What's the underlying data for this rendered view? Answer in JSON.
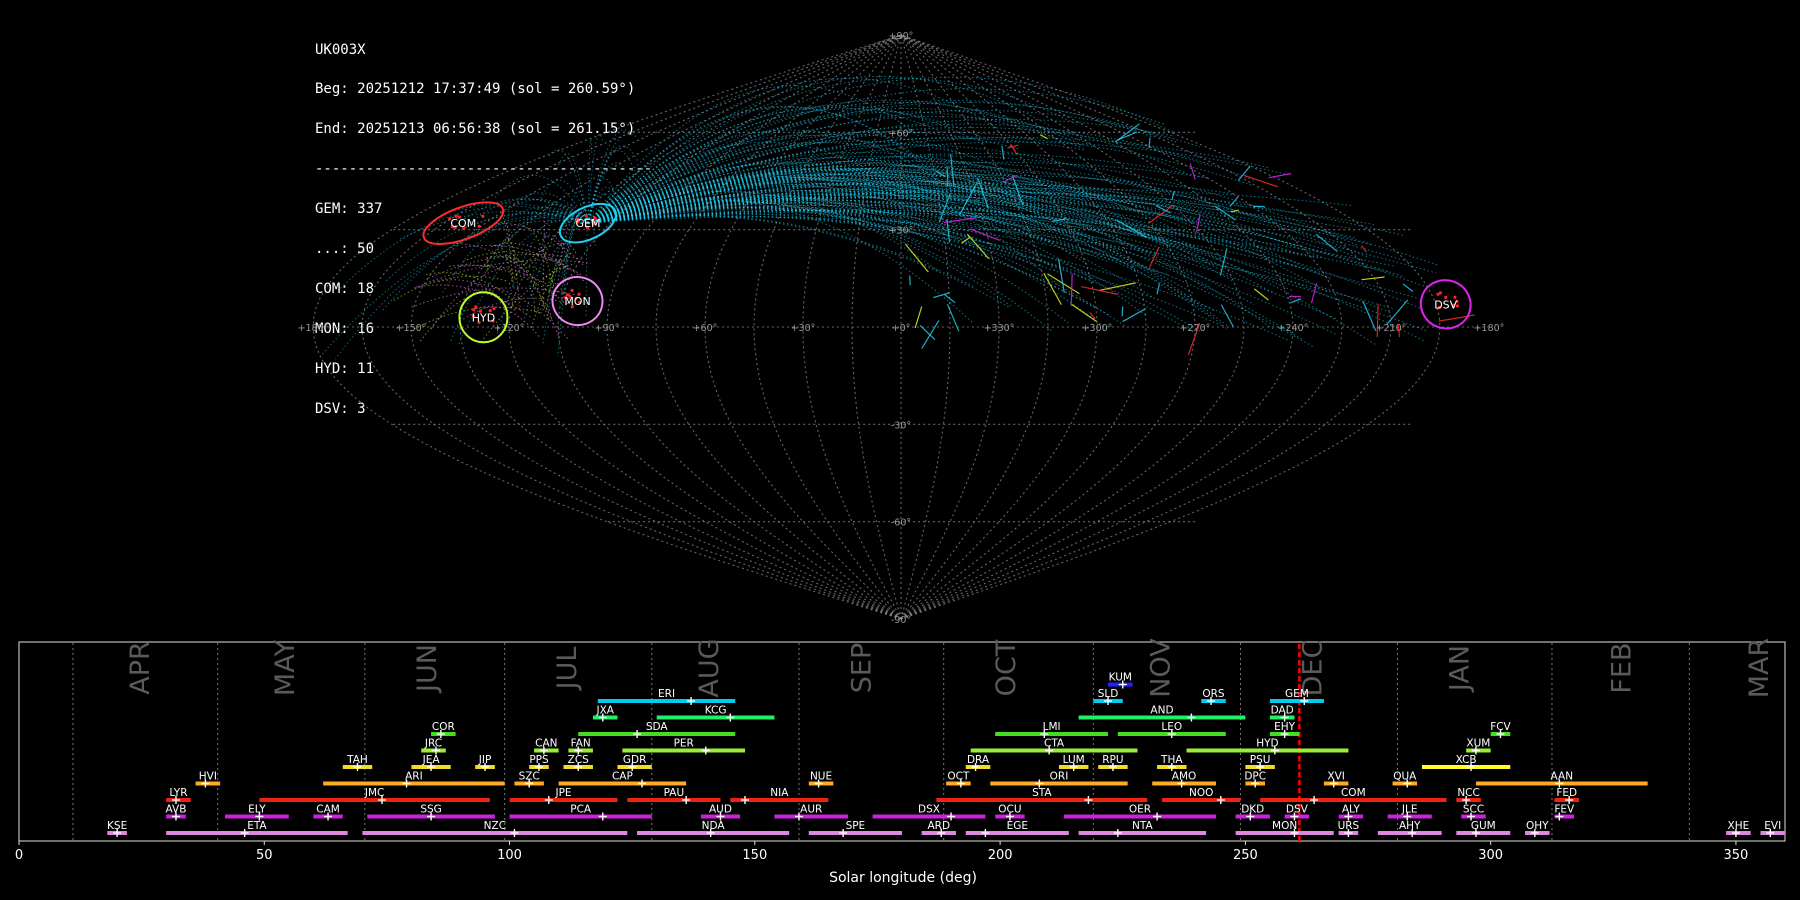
{
  "info": {
    "station": "UK003X",
    "begin": "Beg: 20251212 17:37:49 (sol = 260.59°)",
    "end": "End: 20251213 06:56:38 (sol = 261.15°)",
    "separator": "----------------------------------------",
    "counts": [
      "GEM: 337",
      "...: 50",
      "COM: 18",
      "MON: 16",
      "HYD: 11",
      "DSV: 3"
    ]
  },
  "colors": {
    "background": "#000000",
    "sporadic": "#22ccee",
    "grid": "#888888",
    "GEM": "#ff2a2a",
    "COM": "#ff2a2a",
    "MON": "#ee88ee",
    "HYD": "#bbff22",
    "DSV": "#dd22ee",
    "current_sol_marker": "#ff0000"
  },
  "sky_map": {
    "projection": "sinusoidal",
    "lon_labels": [
      "+180°",
      "+150°",
      "+120°",
      "+90°",
      "+60°",
      "+30°",
      "+0°",
      "+330°",
      "+300°",
      "+270°",
      "+240°",
      "+210°",
      "+180°"
    ],
    "lat_labels": [
      "+90°",
      "+60°",
      "+30°",
      "-30°",
      "-60°",
      "-90°"
    ],
    "radiants": [
      {
        "code": "GEM",
        "ra": 113,
        "dec": 32
      },
      {
        "code": "COM",
        "ra": 158,
        "dec": 32
      },
      {
        "code": "MON",
        "ra": 100,
        "dec": 8
      },
      {
        "code": "HYD",
        "ra": 128,
        "dec": 3
      },
      {
        "code": "DSV",
        "ra": 192,
        "dec": 7
      }
    ]
  },
  "chart_data": {
    "type": "timeline",
    "xlabel": "Solar longitude (deg)",
    "xlim": [
      0,
      360
    ],
    "xticks": [
      0,
      50,
      100,
      150,
      200,
      250,
      300,
      350
    ],
    "current_sol": 261,
    "months": [
      {
        "label": "APR",
        "pos": 25
      },
      {
        "label": "MAY",
        "pos": 54.5
      },
      {
        "label": "JUN",
        "pos": 83.5
      },
      {
        "label": "JUL",
        "pos": 112
      },
      {
        "label": "AUG",
        "pos": 141
      },
      {
        "label": "SEP",
        "pos": 172
      },
      {
        "label": "OCT",
        "pos": 201.5
      },
      {
        "label": "NOV",
        "pos": 233
      },
      {
        "label": "DEC",
        "pos": 264
      },
      {
        "label": "JAN",
        "pos": 294
      },
      {
        "label": "FEB",
        "pos": 327
      },
      {
        "label": "MAR",
        "pos": 355
      }
    ],
    "month_boundaries": [
      11,
      40.5,
      70.5,
      99,
      129,
      159,
      188.5,
      219,
      249,
      281,
      312.5,
      340.5
    ],
    "showers": [
      {
        "code": "KUM",
        "start": 222,
        "end": 227,
        "peak": 225,
        "row": 10,
        "color": "#2222ff"
      },
      {
        "code": "ERI",
        "start": 118,
        "end": 146,
        "peak": 137,
        "row": 9,
        "color": "#00ccee"
      },
      {
        "code": "SLD",
        "start": 219,
        "end": 225,
        "peak": 222,
        "row": 9,
        "color": "#00ccee"
      },
      {
        "code": "ORS",
        "start": 241,
        "end": 246,
        "peak": 243,
        "row": 9,
        "color": "#00ccee"
      },
      {
        "code": "GEM",
        "start": 255,
        "end": 266,
        "peak": 262,
        "row": 9,
        "color": "#00ccee"
      },
      {
        "code": "JXA",
        "start": 117,
        "end": 122,
        "peak": 119,
        "row": 8,
        "color": "#22ee66"
      },
      {
        "code": "KCG",
        "start": 130,
        "end": 154,
        "peak": 145,
        "row": 8,
        "color": "#22ee66"
      },
      {
        "code": "AND",
        "start": 216,
        "end": 250,
        "peak": 239,
        "row": 8,
        "color": "#22ee66"
      },
      {
        "code": "DAD",
        "start": 255,
        "end": 260,
        "peak": 258,
        "row": 8,
        "color": "#22ee66"
      },
      {
        "code": "COR",
        "start": 84,
        "end": 89,
        "peak": 86,
        "row": 7,
        "color": "#44dd22"
      },
      {
        "code": "SDA",
        "start": 114,
        "end": 146,
        "peak": 126,
        "row": 7,
        "color": "#44dd22"
      },
      {
        "code": "LMI",
        "start": 199,
        "end": 222,
        "peak": 209,
        "row": 7,
        "color": "#44dd22"
      },
      {
        "code": "LEO",
        "start": 224,
        "end": 246,
        "peak": 235,
        "row": 7,
        "color": "#44dd22"
      },
      {
        "code": "EHY",
        "start": 255,
        "end": 261,
        "peak": 258,
        "row": 7,
        "color": "#44dd22"
      },
      {
        "code": "FCV",
        "start": 300,
        "end": 304,
        "peak": 302,
        "row": 7,
        "color": "#44dd22"
      },
      {
        "code": "JRC",
        "start": 82,
        "end": 87,
        "peak": 85,
        "row": 6,
        "color": "#99ee33"
      },
      {
        "code": "CAN",
        "start": 105,
        "end": 110,
        "peak": 107,
        "row": 6,
        "color": "#99ee33"
      },
      {
        "code": "FAN",
        "start": 112,
        "end": 117,
        "peak": 114,
        "row": 6,
        "color": "#99ee33"
      },
      {
        "code": "PER",
        "start": 123,
        "end": 148,
        "peak": 140,
        "row": 6,
        "color": "#99ee33"
      },
      {
        "code": "CTA",
        "start": 194,
        "end": 228,
        "peak": 210,
        "row": 6,
        "color": "#99ee33"
      },
      {
        "code": "HYD",
        "start": 238,
        "end": 271,
        "peak": 256,
        "row": 6,
        "color": "#99ee33"
      },
      {
        "code": "XUM",
        "start": 295,
        "end": 300,
        "peak": 297,
        "row": 6,
        "color": "#99ee33"
      },
      {
        "code": "TAH",
        "start": 66,
        "end": 72,
        "peak": 69,
        "row": 5,
        "color": "#eedd22"
      },
      {
        "code": "JEA",
        "start": 80,
        "end": 88,
        "peak": 84,
        "row": 5,
        "color": "#eedd22"
      },
      {
        "code": "JIP",
        "start": 93,
        "end": 97,
        "peak": 95,
        "row": 5,
        "color": "#eedd22"
      },
      {
        "code": "PPS",
        "start": 104,
        "end": 108,
        "peak": 106,
        "row": 5,
        "color": "#eedd22"
      },
      {
        "code": "ZCS",
        "start": 111,
        "end": 117,
        "peak": 114,
        "row": 5,
        "color": "#eedd22"
      },
      {
        "code": "GDR",
        "start": 122,
        "end": 129,
        "peak": 125,
        "row": 5,
        "color": "#eedd22"
      },
      {
        "code": "DRA",
        "start": 193,
        "end": 198,
        "peak": 195,
        "row": 5,
        "color": "#eedd22"
      },
      {
        "code": "LUM",
        "start": 212,
        "end": 218,
        "peak": 215,
        "row": 5,
        "color": "#eedd22"
      },
      {
        "code": "RPU",
        "start": 220,
        "end": 226,
        "peak": 223,
        "row": 5,
        "color": "#eedd22"
      },
      {
        "code": "THA",
        "start": 232,
        "end": 238,
        "peak": 235,
        "row": 5,
        "color": "#eedd22"
      },
      {
        "code": "PSU",
        "start": 250,
        "end": 256,
        "peak": 253,
        "row": 5,
        "color": "#eedd22"
      },
      {
        "code": "XCB",
        "start": 286,
        "end": 304,
        "peak": 296,
        "row": 5,
        "color": "#ffff22"
      },
      {
        "code": "HVI",
        "start": 36,
        "end": 41,
        "peak": 38,
        "row": 4,
        "color": "#ffaa22"
      },
      {
        "code": "ARI",
        "start": 62,
        "end": 99,
        "peak": 79,
        "row": 4,
        "color": "#ffaa22"
      },
      {
        "code": "SZC",
        "start": 101,
        "end": 107,
        "peak": 104,
        "row": 4,
        "color": "#ffaa22"
      },
      {
        "code": "CAP",
        "start": 110,
        "end": 136,
        "peak": 127,
        "row": 4,
        "color": "#ffaa22"
      },
      {
        "code": "NUE",
        "start": 161,
        "end": 166,
        "peak": 163,
        "row": 4,
        "color": "#ffaa22"
      },
      {
        "code": "OCT",
        "start": 189,
        "end": 194,
        "peak": 192,
        "row": 4,
        "color": "#ffaa22"
      },
      {
        "code": "ORI",
        "start": 198,
        "end": 226,
        "peak": 208,
        "row": 4,
        "color": "#ffaa22"
      },
      {
        "code": "AMO",
        "start": 231,
        "end": 244,
        "peak": 237,
        "row": 4,
        "color": "#ffaa22"
      },
      {
        "code": "DPC",
        "start": 250,
        "end": 254,
        "peak": 252,
        "row": 4,
        "color": "#ffaa22"
      },
      {
        "code": "XVI",
        "start": 266,
        "end": 271,
        "peak": 268,
        "row": 4,
        "color": "#ffaa22"
      },
      {
        "code": "QUA",
        "start": 280,
        "end": 285,
        "peak": 283,
        "row": 4,
        "color": "#ffaa22"
      },
      {
        "code": "AAN",
        "start": 297,
        "end": 332,
        "peak": 314,
        "row": 4,
        "color": "#ffaa22"
      },
      {
        "code": "LYR",
        "start": 30,
        "end": 35,
        "peak": 32,
        "row": 3,
        "color": "#ee2211"
      },
      {
        "code": "JMC",
        "start": 49,
        "end": 96,
        "peak": 74,
        "row": 3,
        "color": "#ee2211"
      },
      {
        "code": "JPE",
        "start": 100,
        "end": 122,
        "peak": 108,
        "row": 3,
        "color": "#ee2211"
      },
      {
        "code": "PAU",
        "start": 124,
        "end": 143,
        "peak": 136,
        "row": 3,
        "color": "#ee2211"
      },
      {
        "code": "NIA",
        "start": 145,
        "end": 165,
        "peak": 148,
        "row": 3,
        "color": "#ee2211"
      },
      {
        "code": "STA",
        "start": 187,
        "end": 230,
        "peak": 218,
        "row": 3,
        "color": "#ee2211"
      },
      {
        "code": "NOO",
        "start": 233,
        "end": 249,
        "peak": 245,
        "row": 3,
        "color": "#ee2211"
      },
      {
        "code": "COM",
        "start": 253,
        "end": 291,
        "peak": 264,
        "row": 3,
        "color": "#ee2211"
      },
      {
        "code": "NCC",
        "start": 293,
        "end": 298,
        "peak": 295,
        "row": 3,
        "color": "#ee2211"
      },
      {
        "code": "FED",
        "start": 313,
        "end": 318,
        "peak": 316,
        "row": 3,
        "color": "#ee2211"
      },
      {
        "code": "AVB",
        "start": 30,
        "end": 34,
        "peak": 32,
        "row": 2,
        "color": "#cc22dd"
      },
      {
        "code": "ELY",
        "start": 42,
        "end": 55,
        "peak": 49,
        "row": 2,
        "color": "#cc22dd"
      },
      {
        "code": "CAM",
        "start": 60,
        "end": 66,
        "peak": 63,
        "row": 2,
        "color": "#cc22dd"
      },
      {
        "code": "SSG",
        "start": 71,
        "end": 97,
        "peak": 84,
        "row": 2,
        "color": "#cc22dd"
      },
      {
        "code": "PCA",
        "start": 100,
        "end": 129,
        "peak": 119,
        "row": 2,
        "color": "#cc22dd"
      },
      {
        "code": "AUD",
        "start": 139,
        "end": 147,
        "peak": 143,
        "row": 2,
        "color": "#cc22dd"
      },
      {
        "code": "AUR",
        "start": 154,
        "end": 169,
        "peak": 159,
        "row": 2,
        "color": "#cc22dd"
      },
      {
        "code": "DSX",
        "start": 174,
        "end": 197,
        "peak": 190,
        "row": 2,
        "color": "#cc22dd"
      },
      {
        "code": "OCU",
        "start": 199,
        "end": 205,
        "peak": 202,
        "row": 2,
        "color": "#cc22dd"
      },
      {
        "code": "OER",
        "start": 213,
        "end": 244,
        "peak": 232,
        "row": 2,
        "color": "#cc22dd"
      },
      {
        "code": "DKD",
        "start": 248,
        "end": 255,
        "peak": 251,
        "row": 2,
        "color": "#cc22dd"
      },
      {
        "code": "DSV",
        "start": 258,
        "end": 263,
        "peak": 260,
        "row": 2,
        "color": "#cc22dd"
      },
      {
        "code": "ALY",
        "start": 269,
        "end": 274,
        "peak": 271,
        "row": 2,
        "color": "#cc22dd"
      },
      {
        "code": "JLE",
        "start": 279,
        "end": 288,
        "peak": 283,
        "row": 2,
        "color": "#cc22dd"
      },
      {
        "code": "SCC",
        "start": 294,
        "end": 299,
        "peak": 296,
        "row": 2,
        "color": "#cc22dd"
      },
      {
        "code": "FEV",
        "start": 313,
        "end": 317,
        "peak": 314,
        "row": 2,
        "color": "#cc22dd"
      },
      {
        "code": "KSE",
        "start": 18,
        "end": 22,
        "peak": 20,
        "row": 1,
        "color": "#dd88dd"
      },
      {
        "code": "ETA",
        "start": 30,
        "end": 67,
        "peak": 46,
        "row": 1,
        "color": "#dd88dd"
      },
      {
        "code": "NZC",
        "start": 70,
        "end": 124,
        "peak": 101,
        "row": 1,
        "color": "#dd88dd"
      },
      {
        "code": "NDA",
        "start": 126,
        "end": 157,
        "peak": 141,
        "row": 1,
        "color": "#dd88dd"
      },
      {
        "code": "SPE",
        "start": 161,
        "end": 180,
        "peak": 168,
        "row": 1,
        "color": "#dd88dd"
      },
      {
        "code": "ARD",
        "start": 184,
        "end": 191,
        "peak": 188,
        "row": 1,
        "color": "#dd88dd"
      },
      {
        "code": "EGE",
        "start": 193,
        "end": 214,
        "peak": 197,
        "row": 1,
        "color": "#dd88dd"
      },
      {
        "code": "NTA",
        "start": 216,
        "end": 242,
        "peak": 224,
        "row": 1,
        "color": "#dd88dd"
      },
      {
        "code": "MON",
        "start": 248,
        "end": 268,
        "peak": 260,
        "row": 1,
        "color": "#dd88dd"
      },
      {
        "code": "URS",
        "start": 269,
        "end": 273,
        "peak": 271,
        "row": 1,
        "color": "#dd88dd"
      },
      {
        "code": "AHY",
        "start": 277,
        "end": 290,
        "peak": 284,
        "row": 1,
        "color": "#dd88dd"
      },
      {
        "code": "GUM",
        "start": 293,
        "end": 304,
        "peak": 297,
        "row": 1,
        "color": "#dd88dd"
      },
      {
        "code": "OHY",
        "start": 307,
        "end": 312,
        "peak": 309,
        "row": 1,
        "color": "#dd88dd"
      },
      {
        "code": "XHE",
        "start": 348,
        "end": 353,
        "peak": 350,
        "row": 1,
        "color": "#dd88dd"
      },
      {
        "code": "EVI",
        "start": 355,
        "end": 360,
        "peak": 357,
        "row": 1,
        "color": "#dd88dd"
      }
    ]
  }
}
